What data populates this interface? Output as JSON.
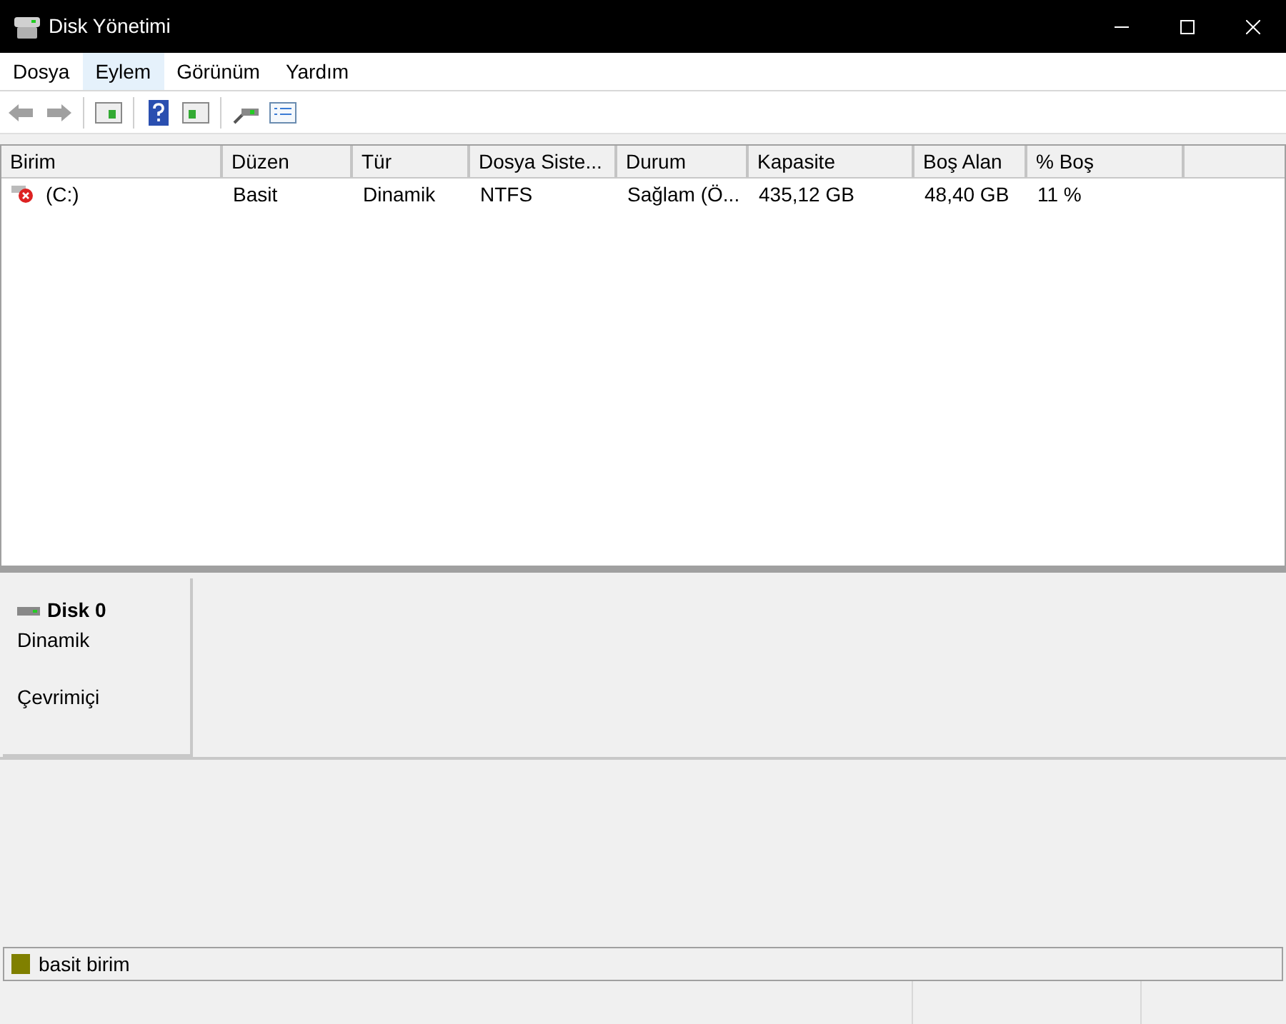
{
  "window": {
    "title": "Disk Yönetimi"
  },
  "menu": [
    {
      "label": "Dosya",
      "selected": false
    },
    {
      "label": "Eylem",
      "selected": true
    },
    {
      "label": "Görünüm",
      "selected": false
    },
    {
      "label": "Yardım",
      "selected": false
    }
  ],
  "table": {
    "columns": [
      "Birim",
      "Düzen",
      "Tür",
      "Dosya Siste...",
      "Durum",
      "Kapasite",
      "Boş Alan",
      "% Boş"
    ],
    "rows": [
      [
        "(C:)",
        "Basit",
        "Dinamik",
        "NTFS",
        "Sağlam (Ö...",
        "435,12 GB",
        "48,40 GB",
        "11 %"
      ]
    ]
  },
  "disk": {
    "name": "Disk 0",
    "type": "Dinamik",
    "status": "Çevrimiçi"
  },
  "legend": [
    {
      "label": "basit birim",
      "color": "#808000"
    }
  ]
}
